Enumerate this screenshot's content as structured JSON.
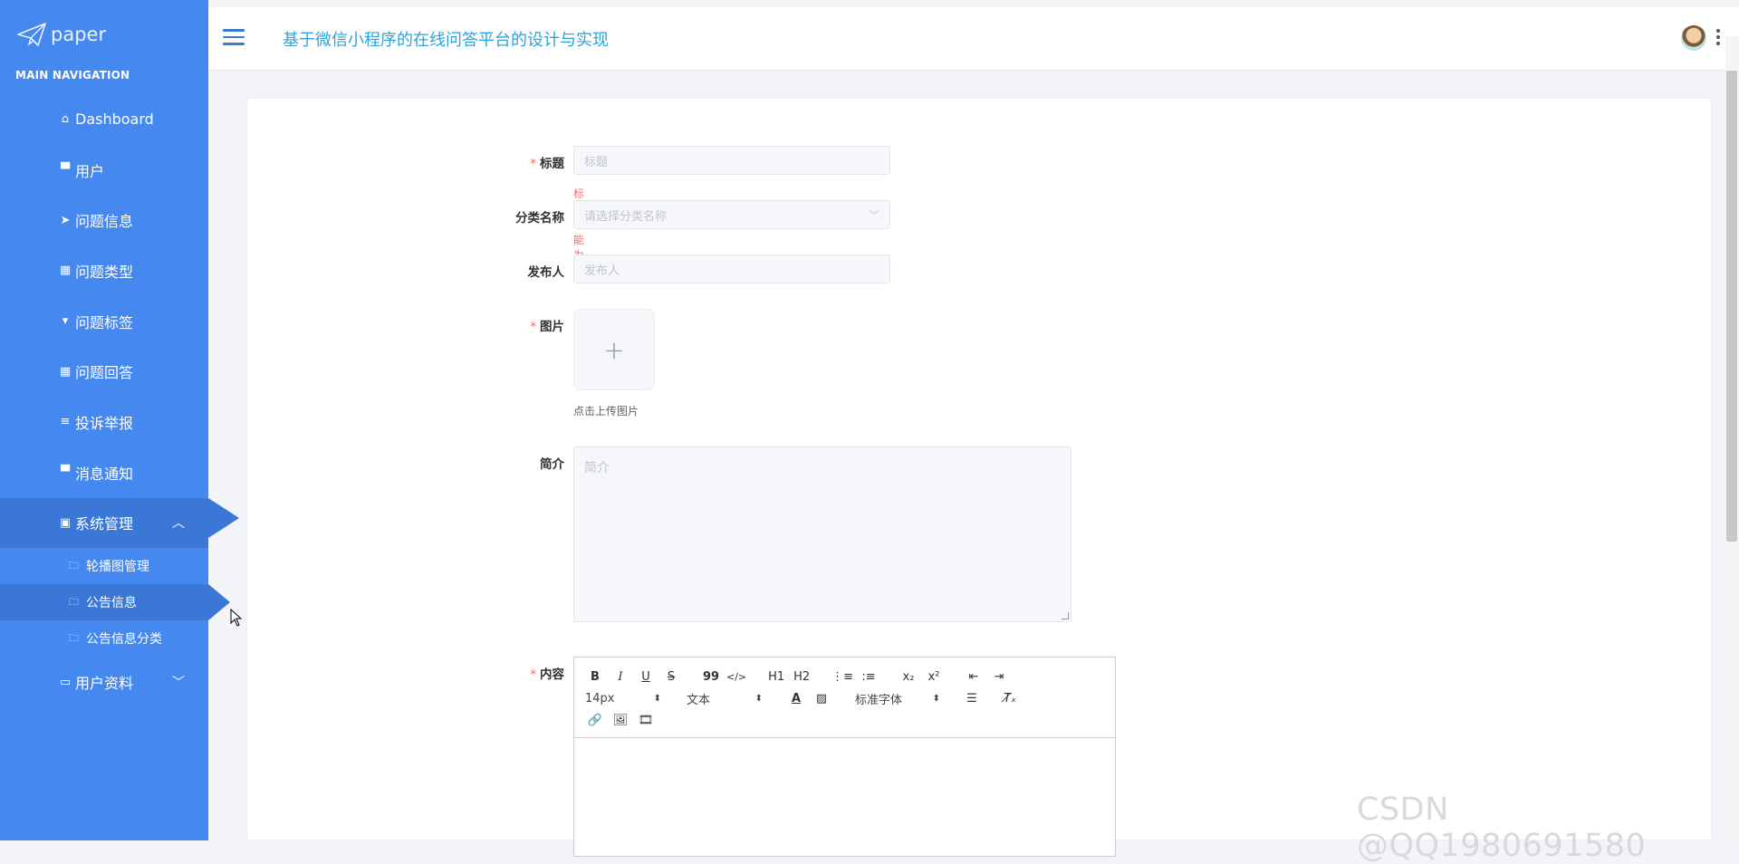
{
  "brand": {
    "name": "paper"
  },
  "nav_caption": "MAIN NAVIGATION",
  "sidebar": {
    "items": [
      {
        "label": "Dashboard",
        "icon": "home-icon"
      },
      {
        "label": "用户",
        "icon": "monitor-icon"
      },
      {
        "label": "问题信息",
        "icon": "send-icon"
      },
      {
        "label": "问题类型",
        "icon": "grid-icon"
      },
      {
        "label": "问题标签",
        "icon": "trophy-icon"
      },
      {
        "label": "问题回答",
        "icon": "grid-icon"
      },
      {
        "label": "投诉举报",
        "icon": "list-icon"
      },
      {
        "label": "消息通知",
        "icon": "monitor-icon"
      },
      {
        "label": "系统管理",
        "icon": "clipboard-icon",
        "expanded": true
      },
      {
        "label": "用户资料",
        "icon": "calendar-icon",
        "expanded": false
      }
    ],
    "sub_items": [
      {
        "label": "轮播图管理",
        "icon": "folder-icon"
      },
      {
        "label": "公告信息",
        "icon": "folder-icon",
        "active": true
      },
      {
        "label": "公告信息分类",
        "icon": "folder-icon"
      }
    ]
  },
  "header": {
    "title": "基于微信小程序的在线问答平台的设计与实现"
  },
  "form": {
    "title": {
      "label": "标题",
      "required": true,
      "placeholder": "标题",
      "error": "标题不能为空"
    },
    "category": {
      "label": "分类名称",
      "placeholder": "请选择分类名称"
    },
    "publisher": {
      "label": "发布人",
      "placeholder": "发布人"
    },
    "image": {
      "label": "图片",
      "required": true,
      "plus": "+",
      "tip": "点击上传图片"
    },
    "intro": {
      "label": "简介",
      "placeholder": "简介"
    },
    "content": {
      "label": "内容",
      "required": true
    }
  },
  "editor": {
    "font_size": "14px",
    "header_type": "文本",
    "font_family": "标准字体",
    "buttons": {
      "bold": "B",
      "italic": "I",
      "underline": "U",
      "strike": "S",
      "quote": "99",
      "code": "</>",
      "h1": "H1",
      "h2": "H2",
      "sub": "x₂",
      "sup": "x²"
    }
  },
  "watermark": "CSDN @QQ1980691580",
  "colors": {
    "sidebar": "#4588f0",
    "active": "#3a77d6",
    "title": "#2fa3d9",
    "error": "#f56c6c"
  }
}
